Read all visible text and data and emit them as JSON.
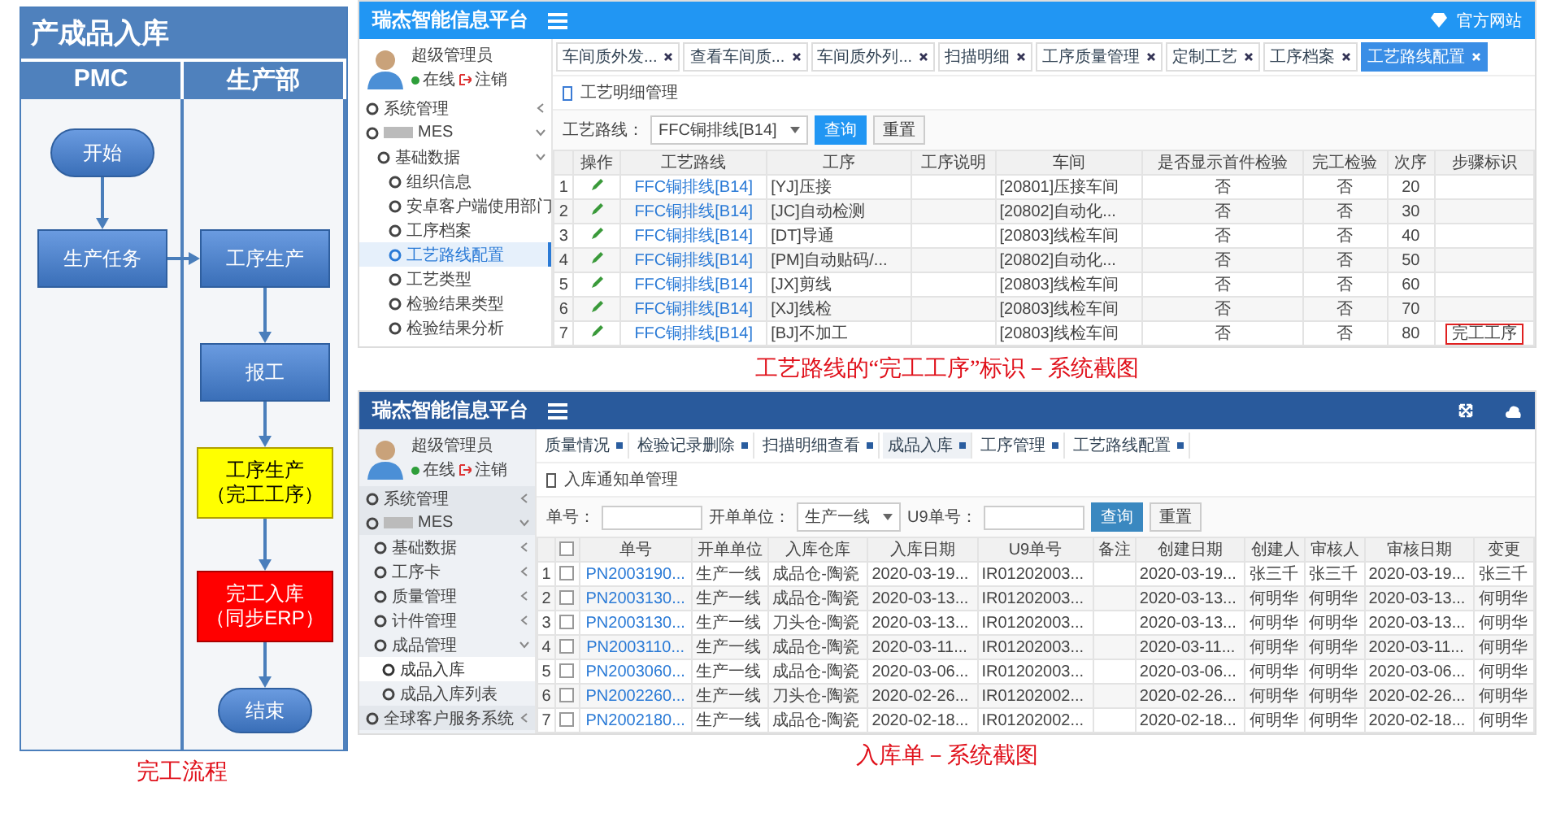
{
  "flowchart": {
    "title": "产成品入库",
    "lanes": [
      {
        "name": "PMC",
        "nodes": [
          {
            "lines": [
              "开始"
            ],
            "kind": "terminal"
          },
          {
            "lines": [
              "生产任务"
            ],
            "kind": "process"
          }
        ]
      },
      {
        "name": "生产部",
        "nodes": [
          {
            "lines": [
              "工序生产"
            ],
            "kind": "process"
          },
          {
            "lines": [
              "报工"
            ],
            "kind": "process"
          },
          {
            "lines": [
              "工序生产",
              "（完工工序）"
            ],
            "kind": "highlight"
          },
          {
            "lines": [
              "完工入库",
              "（同步ERP）"
            ],
            "kind": "alert"
          },
          {
            "lines": [
              "结束"
            ],
            "kind": "terminal"
          }
        ]
      }
    ],
    "caption": "完工流程"
  },
  "route_screen": {
    "app_title": "瑞杰智能信息平台",
    "header_link": "官方网站",
    "user": {
      "name": "超级管理员",
      "status": "在线",
      "logout": "注销"
    },
    "sidebar": [
      {
        "label": "系统管理",
        "expanded": false
      },
      {
        "label": "MES",
        "redacted": true,
        "expanded": true,
        "children": [
          {
            "label": "基础数据",
            "expanded": true,
            "children": [
              {
                "label": "组织信息",
                "selected": false
              },
              {
                "label": "安卓客户端使用部门",
                "selected": false
              },
              {
                "label": "工序档案",
                "selected": false
              },
              {
                "label": "工艺路线配置",
                "selected": true
              },
              {
                "label": "工艺类型",
                "selected": false
              },
              {
                "label": "检验结果类型",
                "selected": false
              },
              {
                "label": "检验结果分析",
                "selected": false
              }
            ]
          }
        ]
      }
    ],
    "tabs": [
      {
        "label": "车间质外发...",
        "selected": false
      },
      {
        "label": "查看车间质...",
        "selected": false
      },
      {
        "label": "车间质外列...",
        "selected": false
      },
      {
        "label": "扫描明细",
        "selected": false
      },
      {
        "label": "工序质量管理",
        "selected": false
      },
      {
        "label": "定制工艺",
        "selected": false
      },
      {
        "label": "工序档案",
        "selected": false
      },
      {
        "label": "工艺路线配置",
        "selected": true
      }
    ],
    "section_title": "工艺明细管理",
    "filter": {
      "label": "工艺路线：",
      "value": "FFC铜排线[B14]",
      "search": "查询",
      "reset": "重置"
    },
    "columns": [
      "操作",
      "工艺路线",
      "工序",
      "工序说明",
      "车间",
      "是否显示首件检验",
      "完工检验",
      "次序",
      "步骤标识"
    ],
    "rows": [
      {
        "no": "1",
        "route": "FFC铜排线[B14]",
        "process": "[YJ]压接",
        "workshop": "[20801]压接车间",
        "first_check": "否",
        "final_check": "否",
        "order": "20"
      },
      {
        "no": "2",
        "route": "FFC铜排线[B14]",
        "process": "[JC]自动检测",
        "workshop": "[20802]自动化...",
        "first_check": "否",
        "final_check": "否",
        "order": "30"
      },
      {
        "no": "3",
        "route": "FFC铜排线[B14]",
        "process": "[DT]导通",
        "workshop": "[20803]线检车间",
        "first_check": "否",
        "final_check": "否",
        "order": "40"
      },
      {
        "no": "4",
        "route": "FFC铜排线[B14]",
        "process": "[PM]自动贴码/...",
        "workshop": "[20802]自动化...",
        "first_check": "否",
        "final_check": "否",
        "order": "50"
      },
      {
        "no": "5",
        "route": "FFC铜排线[B14]",
        "process": "[JX]剪线",
        "workshop": "[20803]线检车间",
        "first_check": "否",
        "final_check": "否",
        "order": "60"
      },
      {
        "no": "6",
        "route": "FFC铜排线[B14]",
        "process": "[XJ]线检",
        "workshop": "[20803]线检车间",
        "first_check": "否",
        "final_check": "否",
        "order": "70"
      },
      {
        "no": "7",
        "route": "FFC铜排线[B14]",
        "process": "[BJ]不加工",
        "workshop": "[20803]线检车间",
        "first_check": "否",
        "final_check": "否",
        "order": "80",
        "step_flag": "完工工序"
      }
    ],
    "caption": "工艺路线的“完工工序”标识－系统截图"
  },
  "receipt_screen": {
    "app_title": "瑞杰智能信息平台",
    "user": {
      "name": "超级管理员",
      "status": "在线",
      "logout": "注销"
    },
    "sidebar": [
      {
        "label": "系统管理",
        "expanded": false
      },
      {
        "label": "MES",
        "redacted": true,
        "expanded": true,
        "children": [
          {
            "label": "基础数据",
            "expanded": false
          },
          {
            "label": "工序卡",
            "expanded": false
          },
          {
            "label": "质量管理",
            "expanded": false
          },
          {
            "label": "计件管理",
            "expanded": false
          },
          {
            "label": "成品管理",
            "expanded": true,
            "children": [
              {
                "label": "成品入库",
                "selected": true
              },
              {
                "label": "成品入库列表",
                "selected": false
              }
            ]
          }
        ]
      },
      {
        "label": "全球客户服务系统",
        "expanded": false
      }
    ],
    "tabs": [
      {
        "label": "质量情况",
        "selected": false
      },
      {
        "label": "检验记录删除",
        "selected": false
      },
      {
        "label": "扫描明细查看",
        "selected": false
      },
      {
        "label": "成品入库",
        "selected": true
      },
      {
        "label": "工序管理",
        "selected": false
      },
      {
        "label": "工艺路线配置",
        "selected": false
      }
    ],
    "section_title": "入库通知单管理",
    "filter": {
      "fields": [
        {
          "label": "单号：",
          "kind": "input"
        },
        {
          "label": "开单单位：",
          "kind": "select",
          "value": "生产一线"
        },
        {
          "label": "U9单号：",
          "kind": "input"
        }
      ],
      "search": "查询",
      "reset": "重置"
    },
    "header_checked": false,
    "columns": [
      "单号",
      "开单单位",
      "入库仓库",
      "入库日期",
      "U9单号",
      "备注",
      "创建日期",
      "创建人",
      "审核人",
      "审核日期",
      "变更"
    ],
    "rows": [
      {
        "no": "1",
        "checked": false,
        "cells": [
          "PN2003190...",
          "生产一线",
          "成品仓-陶瓷",
          "2020-03-19...",
          "IR01202003...",
          null,
          "2020-03-19...",
          "张三千",
          "张三千",
          "2020-03-19...",
          "张三千"
        ]
      },
      {
        "no": "2",
        "checked": false,
        "cells": [
          "PN2003130...",
          "生产一线",
          "成品仓-陶瓷",
          "2020-03-13...",
          "IR01202003...",
          null,
          "2020-03-13...",
          "何明华",
          "何明华",
          "2020-03-13...",
          "何明华"
        ]
      },
      {
        "no": "3",
        "checked": false,
        "cells": [
          "PN2003130...",
          "生产一线",
          "刀头仓-陶瓷",
          "2020-03-13...",
          "IR01202003...",
          null,
          "2020-03-13...",
          "何明华",
          "何明华",
          "2020-03-13...",
          "何明华"
        ]
      },
      {
        "no": "4",
        "checked": false,
        "cells": [
          "PN2003110...",
          "生产一线",
          "成品仓-陶瓷",
          "2020-03-11...",
          "IR01202003...",
          null,
          "2020-03-11...",
          "何明华",
          "何明华",
          "2020-03-11...",
          "何明华"
        ]
      },
      {
        "no": "5",
        "checked": false,
        "cells": [
          "PN2003060...",
          "生产一线",
          "成品仓-陶瓷",
          "2020-03-06...",
          "IR01202003...",
          null,
          "2020-03-06...",
          "何明华",
          "何明华",
          "2020-03-06...",
          "何明华"
        ]
      },
      {
        "no": "6",
        "checked": false,
        "cells": [
          "PN2002260...",
          "生产一线",
          "刀头仓-陶瓷",
          "2020-02-26...",
          "IR01202002...",
          null,
          "2020-02-26...",
          "何明华",
          "何明华",
          "2020-02-26...",
          "何明华"
        ]
      },
      {
        "no": "7",
        "checked": false,
        "cells": [
          "PN2002180...",
          "生产一线",
          "成品仓-陶瓷",
          "2020-02-18...",
          "IR01202002...",
          null,
          "2020-02-18...",
          "何明华",
          "何明华",
          "2020-02-18...",
          "何明华"
        ]
      }
    ],
    "caption": "入库单－系统截图"
  }
}
